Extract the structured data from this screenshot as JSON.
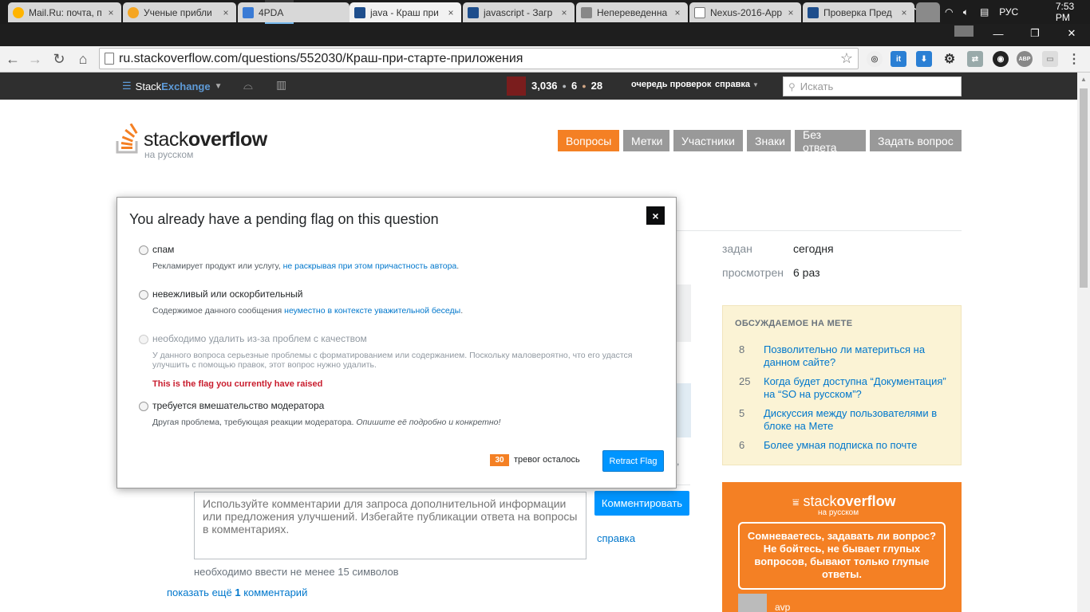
{
  "taskbar": {
    "icons": [
      "windows-start",
      "search",
      "task-view",
      "file-explorer",
      "photoshop",
      "visual-studio",
      "app-cube",
      "app-cube-2",
      "app-network",
      "chrome",
      "app-media",
      "app-video"
    ],
    "tray": {
      "lang": "РУС",
      "time": "7:53 PM"
    }
  },
  "browser": {
    "tabs": [
      {
        "title": "Mail.Ru: почта, п",
        "icon": "mail-icon",
        "active": false
      },
      {
        "title": "Ученые прибли",
        "icon": "clock-icon",
        "active": false
      },
      {
        "title": "4PDA",
        "icon": "4pda-icon",
        "active": false
      },
      {
        "title": "java - Краш при",
        "icon": "so-icon",
        "active": true
      },
      {
        "title": "javascript - Загр",
        "icon": "so-icon",
        "active": false
      },
      {
        "title": "Непереведенна",
        "icon": "meta-icon",
        "active": false
      },
      {
        "title": "Nexus-2016-App",
        "icon": "doc-icon",
        "active": false
      },
      {
        "title": "Проверка Пред",
        "icon": "so-icon",
        "active": false
      }
    ],
    "url": "ru.stackoverflow.com/questions/552030/Краш-при-старте-приложения"
  },
  "topbar": {
    "brand_a": "Stack",
    "brand_b": "Exchange",
    "rep": "3,036",
    "silver": "6",
    "bronze": "28",
    "review": "очередь проверок",
    "help": "справка",
    "search_placeholder": "Искать"
  },
  "site": {
    "logo_a": "stack",
    "logo_b": "overflow",
    "logo_sub": "на русском",
    "nav": [
      {
        "label": "Вопросы",
        "active": true
      },
      {
        "label": "Метки",
        "active": false
      },
      {
        "label": "Участники",
        "active": false
      },
      {
        "label": "Знаки",
        "active": false
      },
      {
        "label": "Без ответа",
        "active": false
      },
      {
        "label": "Задать вопрос",
        "active": false
      }
    ]
  },
  "sidebar": {
    "asked_label": "задан",
    "asked_value": "сегодня",
    "viewed_label": "просмотрен",
    "viewed_value": "6 раз",
    "meta_header": "ОБСУЖДАЕМОЕ НА МЕТЕ",
    "meta_items": [
      {
        "count": "8",
        "title": "Позволительно ли материться на данном сайте?"
      },
      {
        "count": "25",
        "title": "Когда будет доступна “Документация” на “SO на русском”?"
      },
      {
        "count": "5",
        "title": "Дискуссия между пользователями в блоке на Мете"
      },
      {
        "count": "6",
        "title": "Более умная подписка по почте"
      }
    ],
    "ad": {
      "logo_a": "stack",
      "logo_b": "overflow",
      "logo_sub": "на русском",
      "text": "Сомневаетесь, задавать ли вопрос? Не бойтесь, не бывает глупых вопросов, бывают только глупые ответы.",
      "user": "avp"
    }
  },
  "comment": {
    "placeholder": "Используйте комментарии для запроса дополнительной информации или предложения улучшений. Избегайте публикации ответа на вопросы в комментариях.",
    "submit": "Комментировать",
    "help": "справка",
    "min_chars": "необходимо ввести не менее 15 символов",
    "show_more_a": "показать ещё ",
    "show_more_n": "1",
    "show_more_b": " комментарий"
  },
  "modal": {
    "title": "You already have a pending flag on this question",
    "close": "×",
    "options": [
      {
        "label": "спам",
        "desc_a": "Рекламирует продукт или услугу, ",
        "desc_link": "не раскрывая при этом причастность автора",
        "desc_b": ".",
        "disabled": false
      },
      {
        "label": "невежливый или оскорбительный",
        "desc_a": "Содержимое данного сообщения ",
        "desc_link": "неуместно в контексте уважительной беседы",
        "desc_b": ".",
        "disabled": false
      },
      {
        "label": "необходимо удалить из-за проблем с качеством",
        "desc": "У данного вопроса серьезные проблемы с форматированием или содержанием. Поскольку маловероятно, что его удастся улучшить с помощью правок, этот вопрос нужно удалить.",
        "note": "This is the flag you currently have raised",
        "disabled": true
      },
      {
        "label": "требуется вмешательство модератора",
        "desc_a": "Другая проблема, требующая реакции модератора. ",
        "desc_em": "Опишите её подробно и конкретно!",
        "disabled": false
      }
    ],
    "flags_left": "30",
    "flags_left_label": "тревог осталось",
    "retract": "Retract Flag"
  },
  "colors": {
    "so_orange": "#f48024",
    "link": "#0077cc",
    "button": "#0095ff",
    "meta_bg": "#fbf3d5",
    "note": "#c91d2e"
  }
}
